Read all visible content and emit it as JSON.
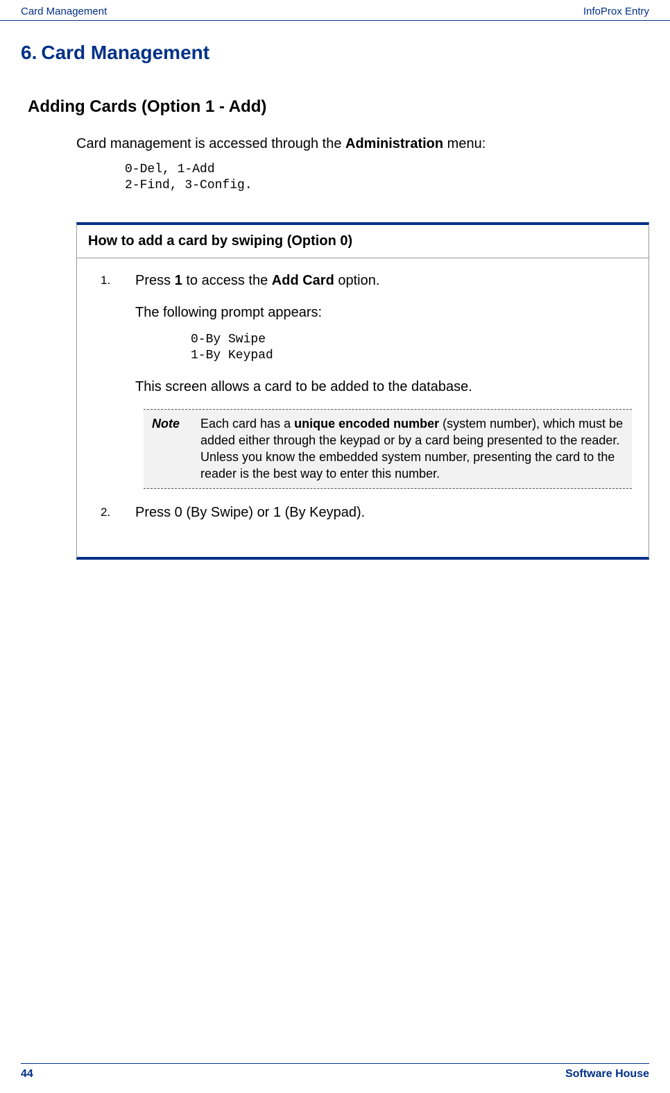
{
  "header": {
    "left": "Card Management",
    "right": "InfoProx Entry"
  },
  "chapter": {
    "number": "6.",
    "title": "Card Management"
  },
  "section": {
    "title": "Adding Cards (Option 1 - Add)"
  },
  "intro": {
    "prefix": "Card management is accessed through the ",
    "bold": "Administration",
    "suffix": " menu:"
  },
  "menu_display": "0-Del, 1-Add\n2-Find, 3-Config.",
  "howto": {
    "header": "How to add a card by swiping (Option 0)",
    "step1": {
      "p1_a": "Press ",
      "p1_b": "1",
      "p1_c": " to access the ",
      "p1_d": "Add Card",
      "p1_e": " option.",
      "p2": "The following prompt appears:",
      "prompt": "0-By Swipe\n1-By Keypad",
      "p3": "This screen allows a card to be added to the database."
    },
    "note": {
      "label": "Note",
      "t1": "Each card has a ",
      "t2": "unique encoded number",
      "t3": " (system number), which must be added either through the keypad or by a card being presented to the reader.  Unless you know the embedded system number, presenting the card to the reader is the best way to enter this number."
    },
    "step2": {
      "text": "Press 0 (By Swipe) or 1 (By Keypad)."
    }
  },
  "footer": {
    "page": "44",
    "brand": "Software House"
  }
}
